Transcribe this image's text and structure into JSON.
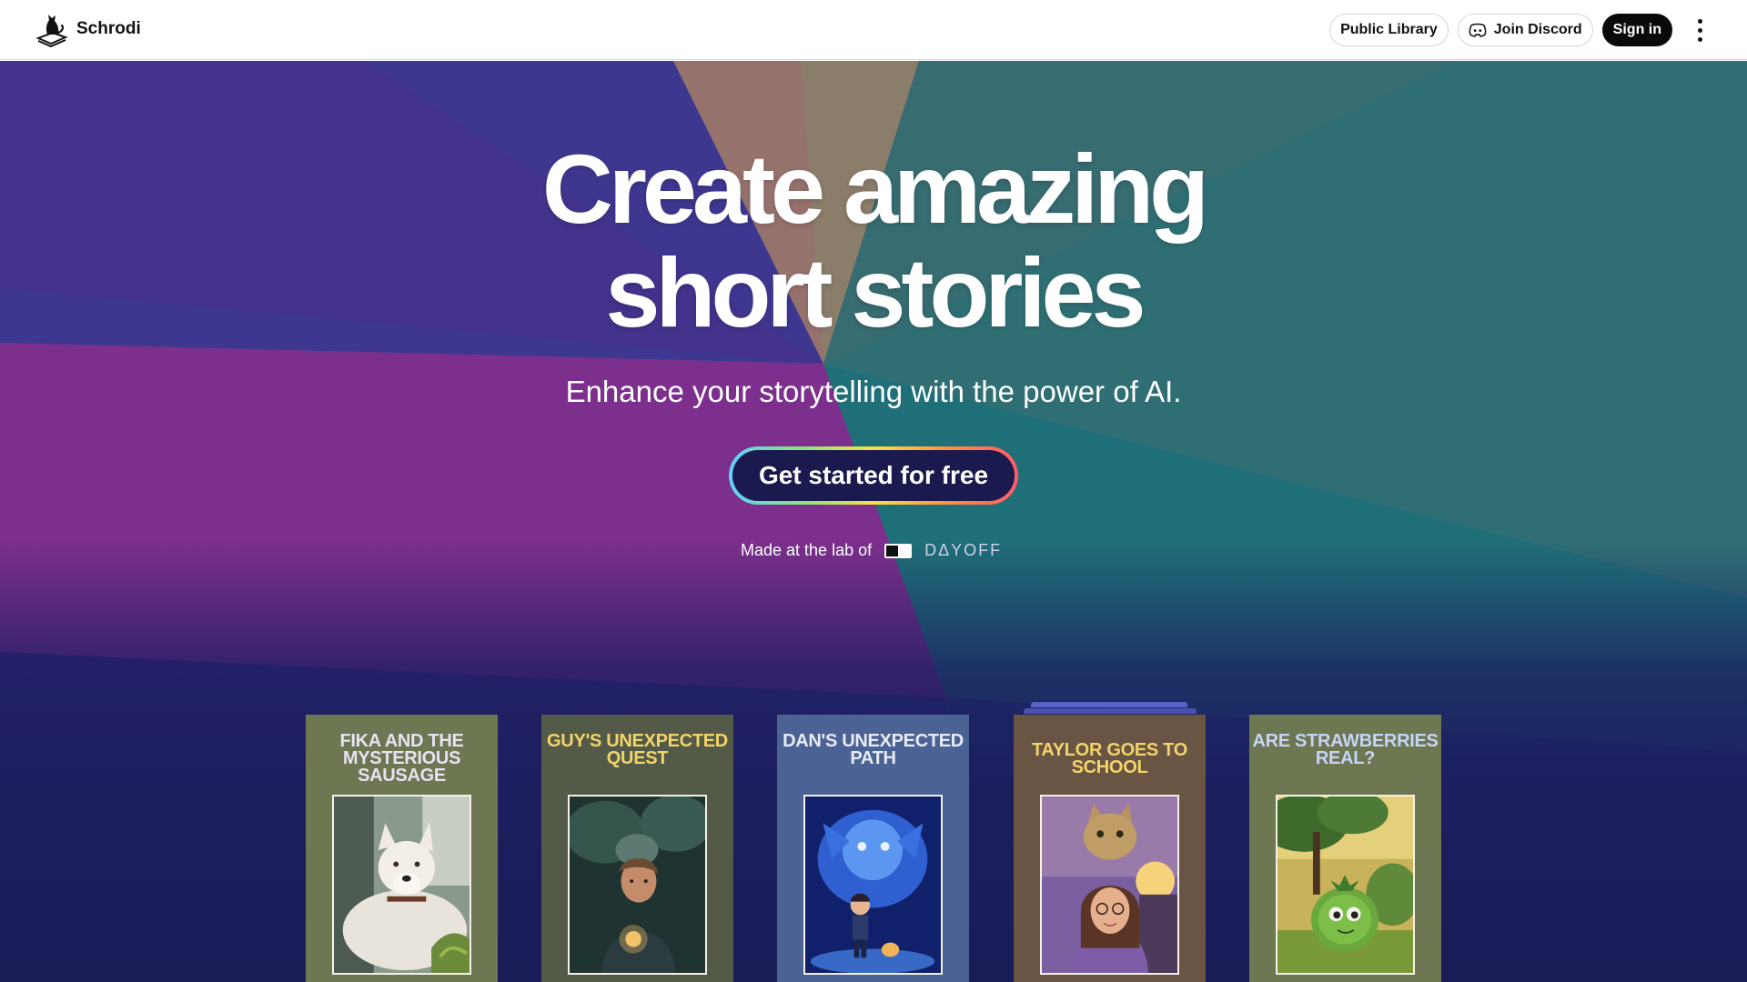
{
  "header": {
    "brand_name": "Schrodi",
    "public_library_label": "Public Library",
    "join_discord_label": "Join Discord",
    "sign_in_label": "Sign in"
  },
  "hero": {
    "headline_line1": "Create amazing",
    "headline_line2": "short stories",
    "subtitle": "Enhance your storytelling with the power of AI.",
    "cta_label": "Get started for free",
    "made_by_text": "Made at the lab of",
    "lab_name": "DΔYOFF"
  },
  "books": [
    {
      "title": "FIKA AND THE MYSTERIOUS SAUSAGE",
      "cover_color": "#6d7752",
      "title_color": "#e7e3f2",
      "image": "white-husky-dog"
    },
    {
      "title": "GUY'S UNEXPECTED QUEST",
      "cover_color": "#535b48",
      "title_color": "#f2d46a",
      "image": "boy-in-forest"
    },
    {
      "title": "DAN'S UNEXPECTED PATH",
      "cover_color": "#4a6394",
      "title_color": "#e8ecf6",
      "image": "boy-with-blue-creature"
    },
    {
      "title": "TAYLOR GOES TO SCHOOL",
      "cover_color": "#6a5443",
      "title_color": "#f2d46a",
      "image": "girl-with-cat"
    },
    {
      "title": "ARE STRAWBERRIES REAL?",
      "cover_color": "#6d7752",
      "title_color": "#c7d4f7",
      "image": "green-fruit-character"
    }
  ],
  "colors": {
    "header_bg": "#ffffff",
    "cta_bg": "#1b1a4e",
    "hero_bottom": "#1c1e5e"
  }
}
